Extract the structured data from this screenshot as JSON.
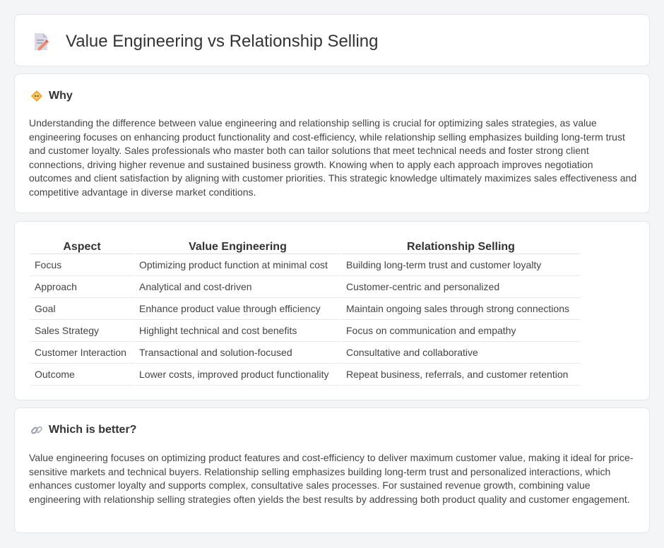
{
  "page": {
    "title": "Value Engineering vs Relationship Selling",
    "title_icon": "document-pencil-icon"
  },
  "why": {
    "icon": "diamond-warning-icon",
    "title": "Why",
    "text": "Understanding the difference between value engineering and relationship selling is crucial for optimizing sales strategies, as value engineering focuses on enhancing product functionality and cost-efficiency, while relationship selling emphasizes building long-term trust and customer loyalty. Sales professionals who master both can tailor solutions that meet technical needs and foster strong client connections, driving higher revenue and sustained business growth. Knowing when to apply each approach improves negotiation outcomes and client satisfaction by aligning with customer priorities. This strategic knowledge ultimately maximizes sales effectiveness and competitive advantage in diverse market conditions."
  },
  "comparison": {
    "headers": [
      "Aspect",
      "Value Engineering",
      "Relationship Selling"
    ],
    "rows": [
      [
        "Focus",
        "Optimizing product function at minimal cost",
        "Building long-term trust and customer loyalty"
      ],
      [
        "Approach",
        "Analytical and cost-driven",
        "Customer-centric and personalized"
      ],
      [
        "Goal",
        "Enhance product value through efficiency",
        "Maintain ongoing sales through strong connections"
      ],
      [
        "Sales Strategy",
        "Highlight technical and cost benefits",
        "Focus on communication and empathy"
      ],
      [
        "Customer Interaction",
        "Transactional and solution-focused",
        "Consultative and collaborative"
      ],
      [
        "Outcome",
        "Lower costs, improved product functionality",
        "Repeat business, referrals, and customer retention"
      ]
    ]
  },
  "better": {
    "icon": "link-icon",
    "title": "Which is better?",
    "text": "Value engineering focuses on optimizing product features and cost-efficiency to deliver maximum customer value, making it ideal for price-sensitive markets and technical buyers. Relationship selling emphasizes building long-term trust and personalized interactions, which enhances customer loyalty and supports complex, consultative sales processes. For sustained revenue growth, combining value engineering with relationship selling strategies often yields the best results by addressing both product quality and customer engagement."
  }
}
